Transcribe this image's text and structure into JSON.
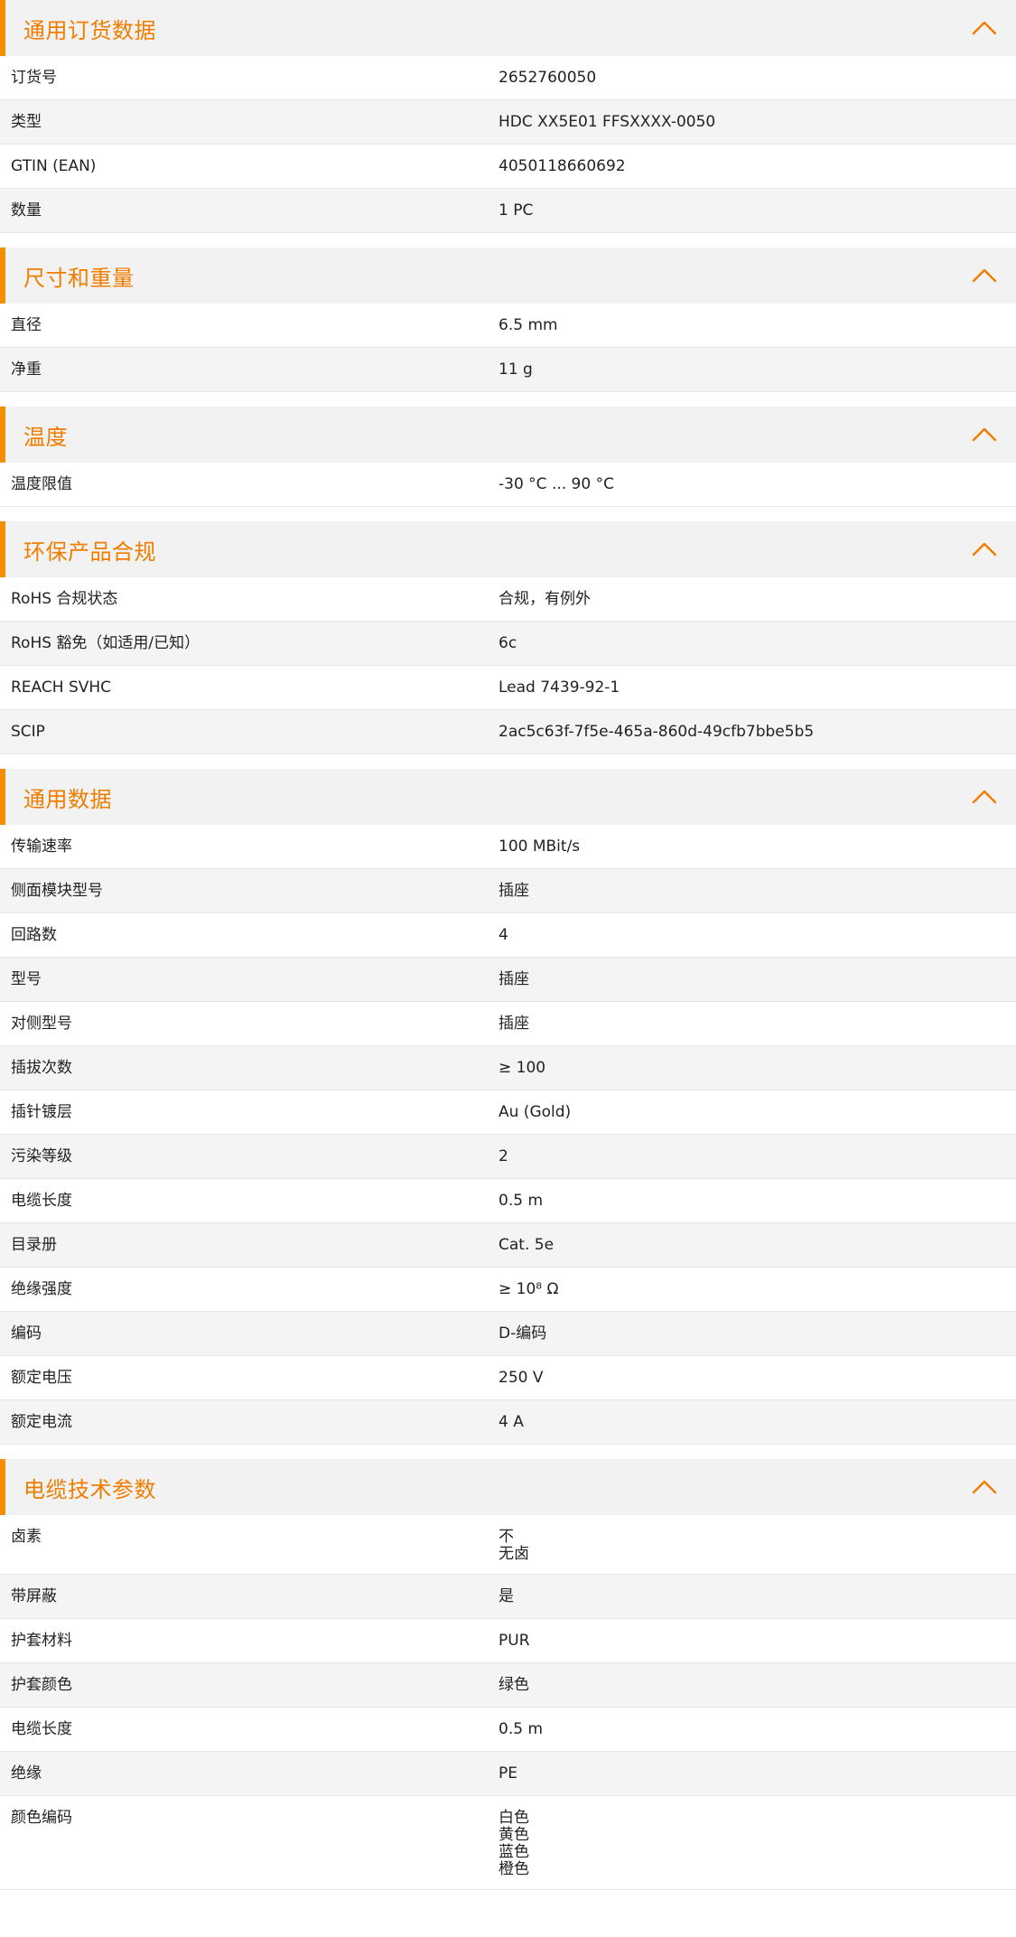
{
  "accent_color": "#f07d00",
  "chevron_icon": "chevron-up-icon",
  "sections": [
    {
      "title": "通用订货数据",
      "rows": [
        {
          "label": "订货号",
          "value": [
            "2652760050"
          ]
        },
        {
          "label": "类型",
          "value": [
            "HDC XX5E01 FFSXXXX-0050"
          ]
        },
        {
          "label": "GTIN (EAN)",
          "value": [
            "4050118660692"
          ]
        },
        {
          "label": "数量",
          "value": [
            "1  PC"
          ]
        }
      ]
    },
    {
      "title": "尺寸和重量",
      "rows": [
        {
          "label": "直径",
          "value": [
            "6.5  mm"
          ]
        },
        {
          "label": "净重",
          "value": [
            "11  g"
          ]
        }
      ]
    },
    {
      "title": "温度",
      "rows": [
        {
          "label": "温度限值",
          "value": [
            "-30 °C ... 90 °C"
          ]
        }
      ]
    },
    {
      "title": "环保产品合规",
      "rows": [
        {
          "label": "RoHS 合规状态",
          "value": [
            "合规，有例外"
          ]
        },
        {
          "label": "RoHS 豁免（如适用/已知）",
          "value": [
            "6c"
          ]
        },
        {
          "label": "REACH SVHC",
          "value": [
            "Lead 7439-92-1"
          ]
        },
        {
          "label": "SCIP",
          "value": [
            "2ac5c63f-7f5e-465a-860d-49cfb7bbe5b5"
          ]
        }
      ]
    },
    {
      "title": "通用数据",
      "rows": [
        {
          "label": "传输速率",
          "value": [
            "100 MBit/s"
          ]
        },
        {
          "label": "侧面模块型号",
          "value": [
            "插座"
          ]
        },
        {
          "label": "回路数",
          "value": [
            "4"
          ]
        },
        {
          "label": "型号",
          "value": [
            "插座"
          ]
        },
        {
          "label": "对侧型号",
          "value": [
            "插座"
          ]
        },
        {
          "label": "插拔次数",
          "value": [
            "≥ 100"
          ]
        },
        {
          "label": "插针镀层",
          "value": [
            "Au (Gold)"
          ]
        },
        {
          "label": "污染等级",
          "value": [
            "2"
          ]
        },
        {
          "label": "电缆长度",
          "value": [
            "0.5  m"
          ]
        },
        {
          "label": "目录册",
          "value": [
            "Cat. 5e"
          ]
        },
        {
          "label": "绝缘强度",
          "value": [
            "≥ 10⁸ Ω"
          ]
        },
        {
          "label": "编码",
          "value": [
            "D-编码"
          ]
        },
        {
          "label": "额定电压",
          "value": [
            "250  V"
          ]
        },
        {
          "label": "额定电流",
          "value": [
            "4  A"
          ]
        }
      ]
    },
    {
      "title": "电缆技术参数",
      "rows": [
        {
          "label": "卤素",
          "value": [
            "不",
            "无卤"
          ]
        },
        {
          "label": "带屏蔽",
          "value": [
            "是"
          ]
        },
        {
          "label": "护套材料",
          "value": [
            "PUR"
          ]
        },
        {
          "label": "护套颜色",
          "value": [
            "绿色"
          ]
        },
        {
          "label": "电缆长度",
          "value": [
            "0.5  m"
          ]
        },
        {
          "label": "绝缘",
          "value": [
            "PE"
          ]
        },
        {
          "label": "颜色编码",
          "value": [
            "白色",
            "黄色",
            "蓝色",
            "橙色"
          ]
        }
      ]
    }
  ]
}
